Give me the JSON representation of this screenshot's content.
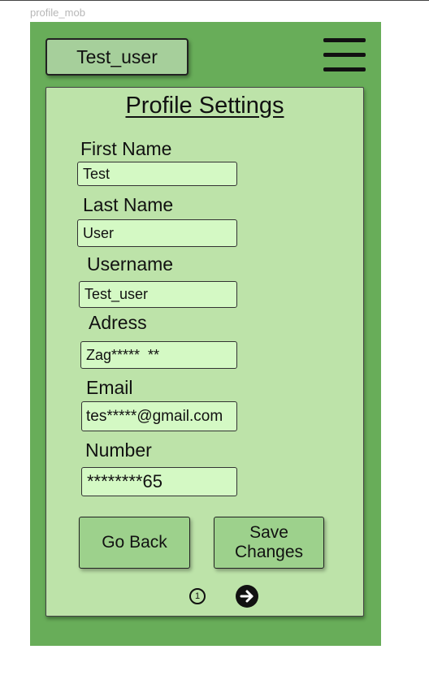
{
  "frame": {
    "label": "profile_mob"
  },
  "header": {
    "username": "Test_user",
    "menu_icon": "hamburger-menu-icon"
  },
  "card": {
    "title": "Profile Settings",
    "fields": {
      "first_name": {
        "label": "First Name",
        "value": "Test"
      },
      "last_name": {
        "label": "Last Name",
        "value": "User"
      },
      "username": {
        "label": "Username",
        "value": "Test_user"
      },
      "address": {
        "label": "Adress",
        "value": "Zag*****  **"
      },
      "email": {
        "label": "Email",
        "value": "tes*****@gmail.com"
      },
      "number": {
        "label": "Number",
        "value": "********65"
      }
    },
    "buttons": {
      "back": "Go Back",
      "save_line1": "Save",
      "save_line2": "Changes"
    },
    "pagination": {
      "current_page": "1",
      "next_icon": "arrow-right-circle-icon"
    }
  }
}
